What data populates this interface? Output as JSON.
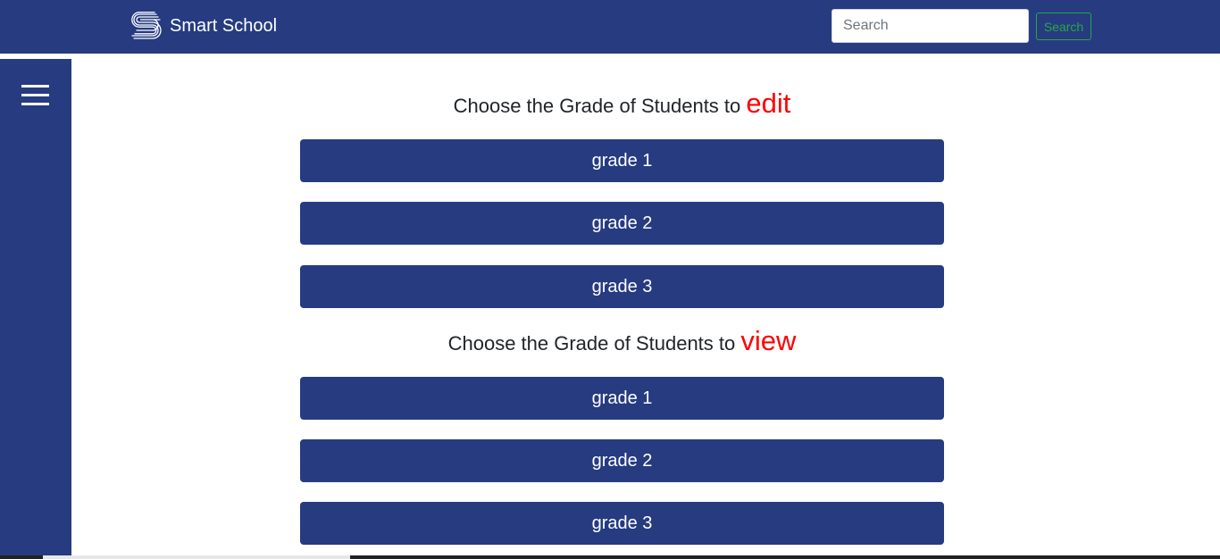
{
  "header": {
    "brand_name": "Smart School",
    "search": {
      "placeholder": "Search",
      "value": "",
      "button_label": "Search"
    }
  },
  "sidebar": {
    "toggle_icon": "hamburger-menu-icon"
  },
  "sections": [
    {
      "heading_prefix": "Choose the Grade of Students to",
      "action_word": "edit",
      "grades": [
        "grade 1",
        "grade 2",
        "grade 3"
      ]
    },
    {
      "heading_prefix": "Choose the Grade of Students to",
      "action_word": "view",
      "grades": [
        "grade 1",
        "grade 2",
        "grade 3"
      ]
    }
  ],
  "colors": {
    "primary": "#263b80",
    "accent_word": "#ff0000",
    "search_button": "#28a745"
  }
}
